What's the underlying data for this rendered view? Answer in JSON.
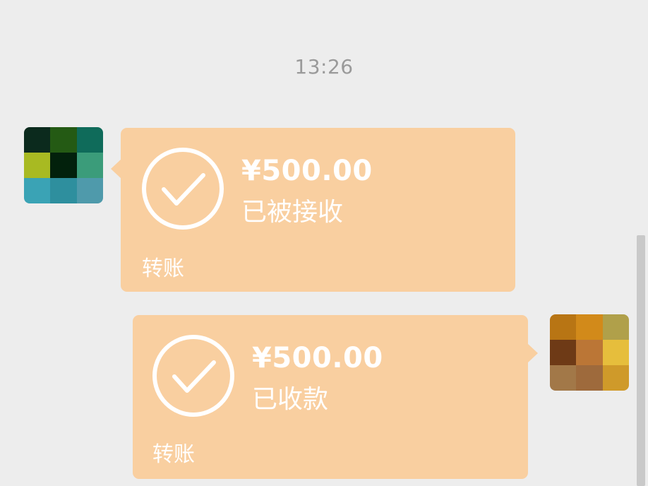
{
  "chat": {
    "timestamp": "13:26",
    "messages": [
      {
        "side": "left",
        "amount": "¥500.00",
        "status": "已被接收",
        "label": "转账",
        "icon": "check-circle-icon",
        "bubble_color": "#f9cfa0"
      },
      {
        "side": "right",
        "amount": "¥500.00",
        "status": "已收款",
        "label": "转账",
        "icon": "check-circle-icon",
        "bubble_color": "#f9cfa0"
      }
    ]
  },
  "avatars": {
    "left": {
      "pixel_colors": [
        "#0b2a1d",
        "#245a14",
        "#0f6b5a",
        "#a8ba22",
        "#02210c",
        "#3b9c7a",
        "#3aa3b5",
        "#2e8f9e",
        "#4f9aab"
      ]
    },
    "right": {
      "pixel_colors": [
        "#b87514",
        "#d28a1a",
        "#b0a04a",
        "#6e3a16",
        "#bb7636",
        "#e6be3c",
        "#a27848",
        "#9e6a3c",
        "#cf9a2a"
      ]
    }
  },
  "colors": {
    "background": "#ededed",
    "bubble": "#f9cfa0",
    "text_on_bubble": "#ffffff",
    "timestamp": "#9a9a9a",
    "scrollbar": "#c9c9c9"
  }
}
